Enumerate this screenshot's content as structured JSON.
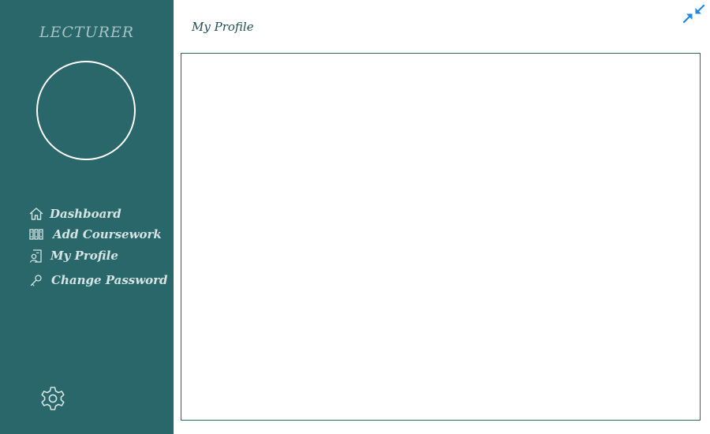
{
  "sidebar": {
    "role_title": "LECTURER",
    "items": [
      {
        "label": "Dashboard",
        "icon": "home-icon"
      },
      {
        "label": "Add Coursework",
        "icon": "books-icon"
      },
      {
        "label": "My Profile",
        "icon": "profile-document-icon"
      },
      {
        "label": "Change Password",
        "icon": "key-icon"
      }
    ],
    "settings_icon": "gear-icon"
  },
  "header": {
    "title": "My Profile",
    "collapse_icon": "collapse-arrows-icon"
  },
  "colors": {
    "sidebar_bg": "#29676a",
    "sidebar_text": "#d6e4e5",
    "accent_blue": "#1e88e5",
    "panel_border": "#29676a"
  }
}
